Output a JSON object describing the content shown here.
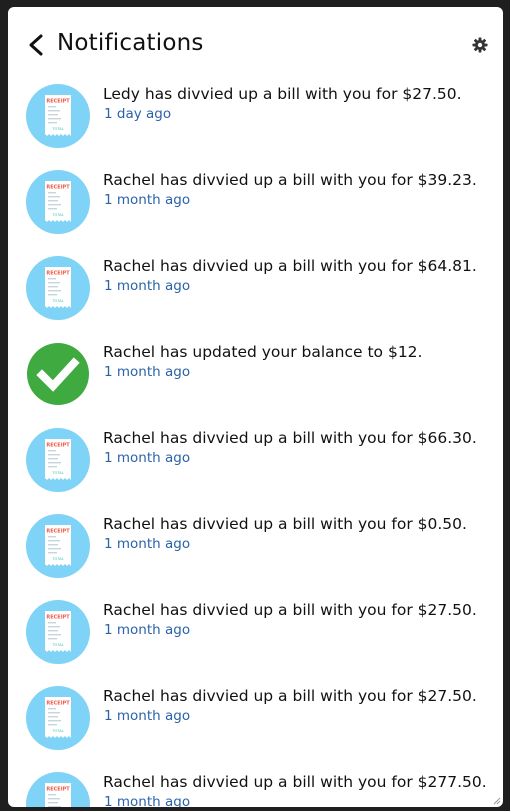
{
  "header": {
    "title": "Notifications",
    "back_icon": "chevron-left-icon",
    "settings_icon": "gear-icon"
  },
  "notifications": [
    {
      "type": "receipt",
      "message": "Ledy has divvied up a bill with you for $27.50.",
      "time": "1 day ago"
    },
    {
      "type": "receipt",
      "message": "Rachel has divvied up a bill with you for $39.23.",
      "time": "1 month ago"
    },
    {
      "type": "receipt",
      "message": "Rachel has divvied up a bill with you for $64.81.",
      "time": "1 month ago"
    },
    {
      "type": "check",
      "message": "Rachel has updated your balance to $12.",
      "time": "1 month ago"
    },
    {
      "type": "receipt",
      "message": "Rachel has divvied up a bill with you for $66.30.",
      "time": "1 month ago"
    },
    {
      "type": "receipt",
      "message": "Rachel has divvied up a bill with you for $0.50.",
      "time": "1 month ago"
    },
    {
      "type": "receipt",
      "message": "Rachel has divvied up a bill with you for $27.50.",
      "time": "1 month ago"
    },
    {
      "type": "receipt",
      "message": "Rachel has divvied up a bill with you for $27.50.",
      "time": "1 month ago"
    },
    {
      "type": "receipt",
      "message": "Rachel has divvied up a bill with you for $277.50.",
      "time": "1 month ago"
    }
  ],
  "receipt_icon": {
    "heading": "RECEIPT",
    "footer": "TOTAL"
  },
  "colors": {
    "receipt_bg": "#7fd3f7",
    "receipt_heading": "#f05a4a",
    "receipt_footer": "#3cc0b0",
    "check_bg": "#3faa3f",
    "time_text": "#2a63a8"
  }
}
